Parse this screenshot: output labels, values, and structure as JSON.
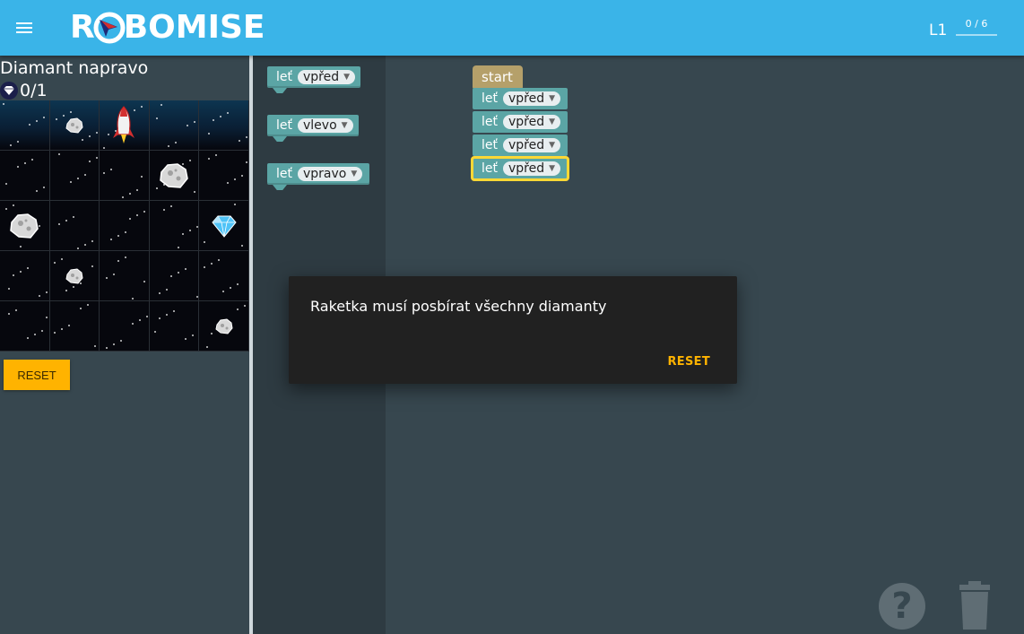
{
  "header": {
    "logo_text_left": "R",
    "logo_text_right": "BOMISE",
    "level": "L1",
    "progress_text": "0 / 6",
    "progress_fraction": 0
  },
  "left": {
    "level_title": "Diamant napravo",
    "diamond_count": "0/1",
    "reset_label": "RESET"
  },
  "board": {
    "rows": [
      [
        "empty",
        "asteroid",
        "rocket",
        "empty",
        "empty"
      ],
      [
        "empty",
        "empty",
        "empty",
        "asteroid",
        "empty"
      ],
      [
        "asteroid",
        "empty",
        "empty",
        "empty",
        "diamond"
      ],
      [
        "empty",
        "asteroid",
        "empty",
        "empty",
        "empty"
      ],
      [
        "empty",
        "empty",
        "empty",
        "empty",
        "asteroid"
      ]
    ]
  },
  "toolbox": {
    "blocks": [
      {
        "label": "leť",
        "value": "vpřed"
      },
      {
        "label": "leť",
        "value": "vlevo"
      },
      {
        "label": "leť",
        "value": "vpravo"
      }
    ]
  },
  "workspace": {
    "start_label": "start",
    "blocks": [
      {
        "label": "leť",
        "value": "vpřed"
      },
      {
        "label": "leť",
        "value": "vpřed"
      },
      {
        "label": "leť",
        "value": "vpřed"
      },
      {
        "label": "leť",
        "value": "vpřed"
      }
    ]
  },
  "dialog": {
    "message": "Raketka musí posbírat všechny diamanty",
    "reset_label": "RESET"
  },
  "icons": {
    "menu": "menu-icon",
    "help": "help-icon",
    "trash": "trash-icon",
    "diamond": "diamond-icon",
    "rocket": "rocket-icon",
    "asteroid": "asteroid-icon"
  },
  "colors": {
    "header": "#3ab4e8",
    "background": "#37474f",
    "block": "#5ba5a5",
    "start_block": "#b5a06a",
    "accent": "#ffb300",
    "selected": "#fdd835"
  }
}
